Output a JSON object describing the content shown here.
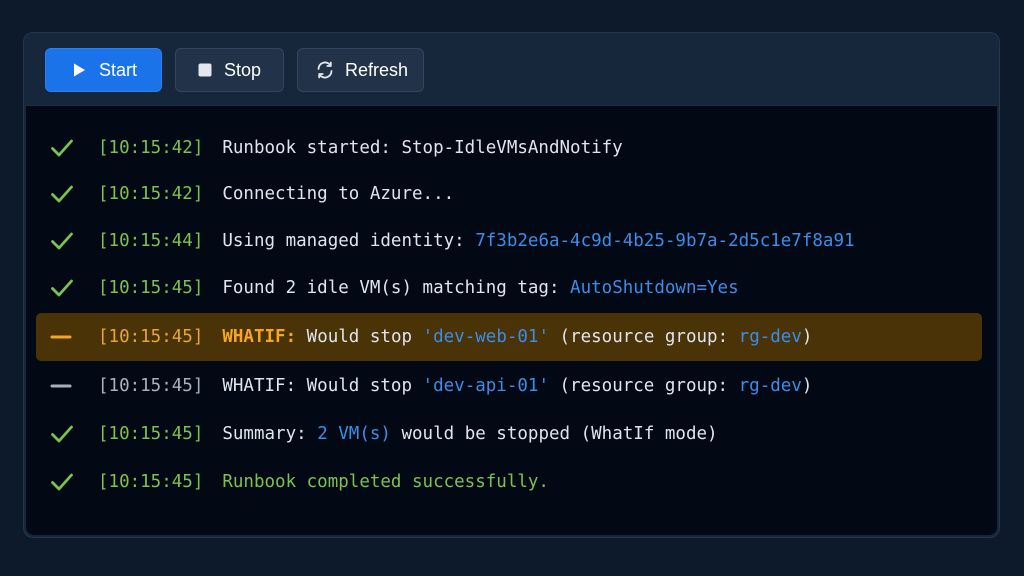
{
  "colors": {
    "accent": "#1a73e8",
    "success": "#7cc152",
    "warning": "#f5a623",
    "link": "#3b8de8",
    "muted": "#a7b1bd"
  },
  "toolbar": {
    "start": {
      "label": "Start",
      "icon": "play-icon"
    },
    "stop": {
      "label": "Stop",
      "icon": "stop-square-icon"
    },
    "refresh": {
      "label": "Refresh",
      "icon": "refresh-icon"
    }
  },
  "log": [
    {
      "status": "success",
      "time": "[10:15:42]",
      "parts": [
        {
          "text": "Runbook started: Stop-IdleVMsAndNotify",
          "style": "white"
        }
      ]
    },
    {
      "status": "success",
      "time": "[10:15:42]",
      "parts": [
        {
          "text": "Connecting to Azure...",
          "style": "white"
        }
      ]
    },
    {
      "status": "success",
      "time": "[10:15:44]",
      "parts": [
        {
          "text": "Using managed identity: ",
          "style": "white"
        },
        {
          "text": "7f3b2e6a-4c9d-4b25-9b7a-2d5c1e7f8a91",
          "style": "blue"
        }
      ]
    },
    {
      "status": "success",
      "time": "[10:15:45]",
      "parts": [
        {
          "text": "Found 2 idle VM(s) matching tag: ",
          "style": "white"
        },
        {
          "text": "AutoShutdown=Yes",
          "style": "blue"
        }
      ]
    },
    {
      "status": "warning",
      "time": "[10:15:45]",
      "parts": [
        {
          "text": "WHATIF:",
          "style": "orange"
        },
        {
          "text": " Would stop ",
          "style": "white"
        },
        {
          "text": "'dev-web-01'",
          "style": "blue"
        },
        {
          "text": " (resource group: ",
          "style": "white"
        },
        {
          "text": "rg-dev",
          "style": "blue"
        },
        {
          "text": ")",
          "style": "white"
        }
      ]
    },
    {
      "status": "neutral",
      "time": "[10:15:45]",
      "parts": [
        {
          "text": "WHATIF: Would stop ",
          "style": "white"
        },
        {
          "text": "'dev-api-01'",
          "style": "blue"
        },
        {
          "text": " (resource group: ",
          "style": "white"
        },
        {
          "text": "rg-dev",
          "style": "blue"
        },
        {
          "text": ")",
          "style": "white"
        }
      ]
    },
    {
      "status": "success",
      "time": "[10:15:45]",
      "parts": [
        {
          "text": "Summary: ",
          "style": "white"
        },
        {
          "text": "2 VM(s)",
          "style": "blue"
        },
        {
          "text": " would be stopped (WhatIf mode)",
          "style": "white"
        }
      ]
    },
    {
      "status": "success",
      "time": "[10:15:45]",
      "parts": [
        {
          "text": "Runbook completed successfully.",
          "style": "green"
        }
      ]
    }
  ]
}
